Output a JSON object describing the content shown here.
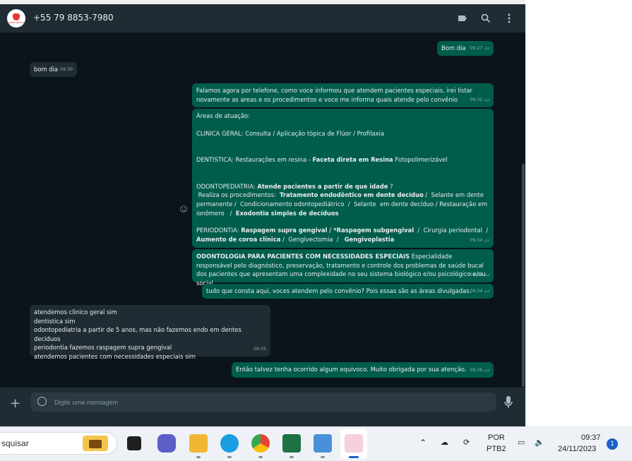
{
  "window": {
    "contact_name": "+55 79 8853-7980",
    "avatar_logo_text": "odontoclínico"
  },
  "header": {
    "icons": [
      "label-icon",
      "search-icon",
      "menu-icon"
    ]
  },
  "messages": [
    {
      "dir": "out",
      "text": "Bom dia",
      "time": "09:27",
      "ticks": "read"
    },
    {
      "dir": "in",
      "text": "bom dia",
      "time": "09:30"
    },
    {
      "dir": "out",
      "text": "Falamos agora por telefone, como voce informou que atendem pacientes especiais, irei listar novamente as areas e os procedimentos e voce me informa quais atende pelo convênio",
      "time": "09:32",
      "ticks": "read"
    },
    {
      "dir": "out",
      "time": "09:34",
      "ticks": "read",
      "parts": {
        "p1": "Áreas de atuação:",
        "p2": "CLINICA GERAL: Consulta /  Aplicação tópica de Flúor  /  Profilaxia",
        "p3a": "DENTISTICA: Restaurações  em resina  -  ",
        "p3b": "Faceta direta em Resina",
        "p3c": " Fotopolimerizável",
        "p4a": "ODONTOPEDIATRIA: ",
        "p4b": "Atende pacientes a partir de que idade",
        "p4c": " ?",
        "p5a": " Realiza os procedimentos:  ",
        "p5b": "Tratamento endodôntico em dente decíduo",
        "p5c": " /  Selante em dente permanente /  Condicionamento odontopediátrico  /  Selante  em dente decíduo / Restauração em ionômero   /  ",
        "p5d": "Exodontia simples de decíduos",
        "p6a": "PERIODONTIA: ",
        "p6b": "Raspagem supra gengival / *Raspagem subgengival",
        "p6c": "  /  Cirurgia periodontal  /  ",
        "p6d": "Aumento de coroa clínica",
        "p6e": " /  Gengivectomia  /   ",
        "p6f": "Gengivoplastia"
      }
    },
    {
      "dir": "out",
      "time": "09:34",
      "ticks": "read",
      "parts": {
        "bold": "ODONTOLOGIA PARA PACIENTES COM NECESSIDADES ESPECIAIS",
        "rest": " Especialidade responsável pelo diagnóstico, preservação, tratamento e controle dos problemas de saúde bucal dos pacientes que apresentam uma complexidade no seu sistema biológico e/ou psicológico e/ou social."
      }
    },
    {
      "dir": "out",
      "text": "tudo que consta aqui, voces atendem pelo convênio? Pois essas são as áreas divulgadas.",
      "time": "09:34",
      "ticks": "read"
    },
    {
      "dir": "in",
      "time": "09:35",
      "lines": [
        "atendemos clinico geral sim",
        "dentistica sim",
        "odontopediatria a partir de 5 anos, mas não fazemos endo em dentes deciduos",
        "periodontia fazemos raspagem supra gengival",
        "atendemos pacientes com necessidades especiais sim"
      ]
    },
    {
      "dir": "out",
      "text": "Então talvez tenha ocorrido algum equivoco. Muito obrigada por sua atenção.",
      "time": "09:36",
      "ticks": "read"
    }
  ],
  "composer": {
    "placeholder": "Digite uma mensagem"
  },
  "taskbar": {
    "search_text": "squisar",
    "apps": [
      "briefcase-icon",
      "task-view-icon",
      "teams-icon",
      "file-explorer-icon",
      "edge-icon",
      "chrome-icon",
      "excel-icon",
      "notepad-icon",
      "snipping-tool-icon"
    ],
    "lang1": "POR",
    "lang2": "PTB2",
    "time": "09:37",
    "date": "24/11/2023",
    "notifications": "1"
  },
  "colors": {
    "bg": "#0b141a",
    "header": "#202c33",
    "outgoing": "#005c4b",
    "incoming": "#202c33"
  }
}
